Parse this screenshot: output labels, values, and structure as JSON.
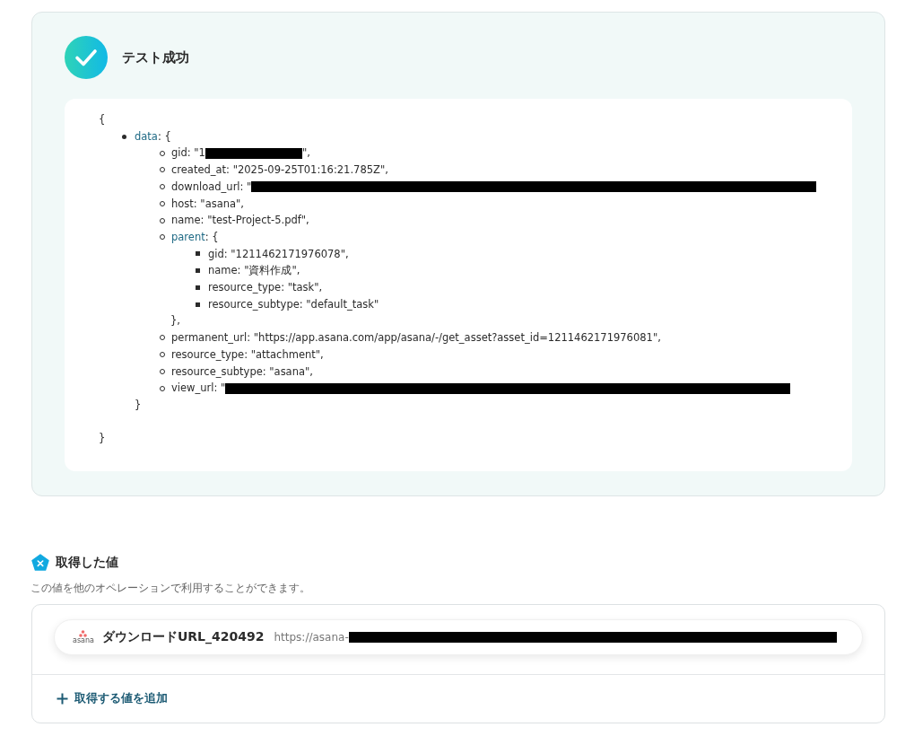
{
  "result": {
    "title": "テスト成功",
    "json": {
      "open": "{",
      "close": "}",
      "items": [
        {
          "key": "data",
          "text": ": {",
          "closing": "}",
          "children": [
            {
              "parts": [
                {
                  "kind": "text",
                  "text": "gid: \"1"
                },
                {
                  "kind": "redacted_short"
                },
                {
                  "kind": "text",
                  "text": "\","
                }
              ]
            },
            {
              "parts": [
                {
                  "kind": "text",
                  "text": "created_at: \"2025-09-25T01:16:21.785Z\","
                }
              ]
            },
            {
              "parts": [
                {
                  "kind": "text",
                  "text": "download_url: \""
                },
                {
                  "kind": "redacted_long"
                }
              ]
            },
            {
              "parts": [
                {
                  "kind": "text",
                  "text": "host: \"asana\","
                }
              ]
            },
            {
              "parts": [
                {
                  "kind": "text",
                  "text": "name: \"test-Project-5.pdf\","
                }
              ]
            },
            {
              "key": "parent",
              "text": ": {",
              "closing": "},",
              "children": [
                {
                  "parts": [
                    {
                      "kind": "text",
                      "text": "gid: \"1211462171976078\","
                    }
                  ]
                },
                {
                  "parts": [
                    {
                      "kind": "text",
                      "text": "name: \"資料作成\","
                    }
                  ]
                },
                {
                  "parts": [
                    {
                      "kind": "text",
                      "text": "resource_type: \"task\","
                    }
                  ]
                },
                {
                  "parts": [
                    {
                      "kind": "text",
                      "text": "resource_subtype: \"default_task\""
                    }
                  ]
                }
              ]
            },
            {
              "parts": [
                {
                  "kind": "text",
                  "text": "permanent_url: \"https://app.asana.com/app/asana/-/get_asset?asset_id=1211462171976081\","
                }
              ]
            },
            {
              "parts": [
                {
                  "kind": "text",
                  "text": "resource_type: \"attachment\","
                }
              ]
            },
            {
              "parts": [
                {
                  "kind": "text",
                  "text": "resource_subtype: \"asana\","
                }
              ]
            },
            {
              "parts": [
                {
                  "kind": "text",
                  "text": "view_url: \""
                },
                {
                  "kind": "redacted_long"
                }
              ]
            }
          ]
        }
      ]
    }
  },
  "values": {
    "title": "取得した値",
    "description": "この値を他のオペレーションで利用することができます。",
    "items": [
      {
        "name": "ダウンロードURL_420492",
        "app_label": "asana",
        "parts": [
          {
            "kind": "text",
            "text": "https://asana-"
          },
          {
            "kind": "redacted_long"
          }
        ]
      }
    ],
    "add_button": "取得する値を追加"
  }
}
